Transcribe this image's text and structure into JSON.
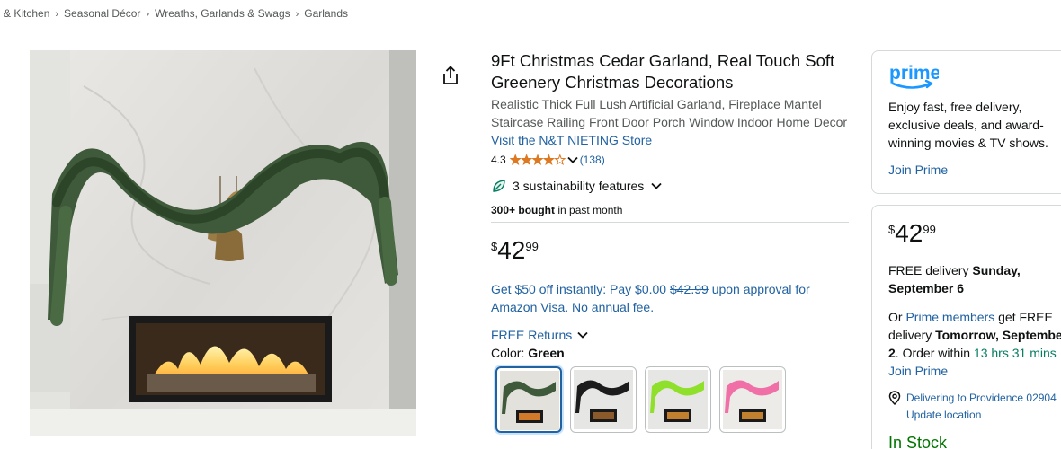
{
  "breadcrumb": {
    "items": [
      "& Kitchen",
      "Seasonal Décor",
      "Wreaths, Garlands & Swags",
      "Garlands"
    ],
    "separator": "›"
  },
  "product": {
    "title": "9Ft Christmas Cedar Garland, Real Touch Soft Greenery Christmas Decorations",
    "subtitle": "Realistic Thick Full Lush Artificial Garland, Fireplace Mantel Staircase Railing Front Door Porch Window Indoor Home Decor",
    "store_link": "Visit the N&T NIETING Store",
    "rating": "4.3",
    "rating_value": 4.3,
    "rating_count": "(138)",
    "sustainability": "3 sustainability features",
    "bought_bold": "300+ bought",
    "bought_rest": " in past month",
    "price": {
      "symbol": "$",
      "whole": "42",
      "fraction": "99"
    },
    "promo_pre": "Get $50 off instantly: Pay $0.00 ",
    "promo_strike": "$42.99",
    "promo_post": " upon approval for Amazon Visa. No annual fee.",
    "returns": "FREE Returns",
    "color_label": "Color: ",
    "color_value": "Green",
    "swatches": [
      "green",
      "black",
      "lime",
      "pink"
    ]
  },
  "prime_box": {
    "text": "Enjoy fast, free delivery, exclusive deals, and award-winning movies & TV shows.",
    "join": "Join Prime",
    "logo_text": "prime"
  },
  "buy_box": {
    "price": {
      "symbol": "$",
      "whole": "42",
      "fraction": "99"
    },
    "delivery_pre": "FREE delivery ",
    "delivery_date": "Sunday, September 6",
    "fast_l1_pre": "Or ",
    "fast_l1_link": "Prime members",
    "fast_l1_post": " get FREE",
    "fast_l2_pre": "delivery ",
    "fast_l2_bold": "Tomorrow, Septembe",
    "fast_l3_bold": "2",
    "fast_l3_mid": ". Order within ",
    "fast_l3_green": "13 hrs 31 mins",
    "fast_l4_link": "Join Prime",
    "deliver_to": "Delivering to Providence 02904",
    "update_location": "Update location",
    "stock": "In Stock"
  },
  "colors": {
    "link": "#2162a1",
    "star": "#de7921",
    "green_text": "#067d62",
    "in_stock": "#007600",
    "prime_blue": "#1a98ff"
  }
}
